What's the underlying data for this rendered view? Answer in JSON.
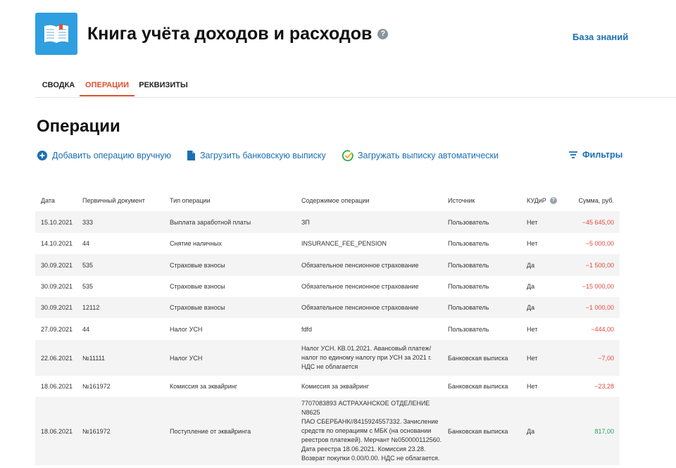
{
  "header": {
    "title": "Книга учёта доходов и расходов",
    "help_icon": "?",
    "knowledge_base": "База знаний",
    "logo_icon": "open-book-icon",
    "accent": "#2f9fe0"
  },
  "tabs": [
    {
      "label": "СВОДКА",
      "active": false
    },
    {
      "label": "ОПЕРАЦИИ",
      "active": true
    },
    {
      "label": "РЕКВИЗИТЫ",
      "active": false
    }
  ],
  "page_title": "Операции",
  "actions": {
    "add_manual": "Добавить операцию вручную",
    "upload_statement": "Загрузить банковскую выписку",
    "auto_upload": "Загружать выписку автоматически",
    "filters": "Фильтры"
  },
  "table": {
    "headers": {
      "date": "Дата",
      "doc": "Первичный документ",
      "type": "Тип операции",
      "content": "Содержимое операции",
      "source": "Источник",
      "kudir": "КУДиР",
      "kudir_help": "?",
      "amount": "Сумма, руб."
    },
    "rows": [
      {
        "date": "15.10.2021",
        "doc": "333",
        "type": "Выплата заработной платы",
        "content": "ЗП",
        "source": "Пользователь",
        "kudir": "Нет",
        "amount": "−45 645,00",
        "sign": "neg"
      },
      {
        "date": "14.10.2021",
        "doc": "44",
        "type": "Снятие наличных",
        "content": "INSURANCE_FEE_PENSION",
        "source": "Пользователь",
        "kudir": "Нет",
        "amount": "−5 000,00",
        "sign": "neg"
      },
      {
        "date": "30.09.2021",
        "doc": "535",
        "type": "Страховые взносы",
        "content": "Обязательное пенсионное страхование",
        "source": "Пользователь",
        "kudir": "Да",
        "amount": "−1 500,00",
        "sign": "neg"
      },
      {
        "date": "30.09.2021",
        "doc": "535",
        "type": "Страховые взносы",
        "content": "Обязательное пенсионное страхование",
        "source": "Пользователь",
        "kudir": "Да",
        "amount": "−15 000,00",
        "sign": "neg"
      },
      {
        "date": "30.09.2021",
        "doc": "12112",
        "type": "Страховые взносы",
        "content": "Обязательное пенсионное страхование",
        "source": "Пользователь",
        "kudir": "Да",
        "amount": "−1 000,00",
        "sign": "neg"
      },
      {
        "date": "27.09.2021",
        "doc": "44",
        "type": "Налог УСН",
        "content": "fdfd",
        "source": "Пользователь",
        "kudir": "Нет",
        "amount": "−444,00",
        "sign": "neg"
      },
      {
        "date": "22.06.2021",
        "doc": "№11111",
        "type": "Налог УСН",
        "content": "Налог УСН. КВ.01.2021. Авансовый платеж/\nналог по единому налогу при УСН за 2021 г.\nНДС не облагается",
        "source": "Банковская выписка",
        "kudir": "Нет",
        "amount": "−7,00",
        "sign": "neg"
      },
      {
        "date": "18.06.2021",
        "doc": "№161972",
        "type": "Комиссия за эквайринг",
        "content": "Комиссия за эквайринг",
        "source": "Банковская выписка",
        "kudir": "Нет",
        "amount": "−23,28",
        "sign": "neg"
      },
      {
        "date": "18.06.2021",
        "doc": "№161972",
        "type": "Поступление от эквайринга",
        "content": "7707083893 АСТРАХАНСКОЕ ОТДЕЛЕНИЕ N8625\nПАО СБЕРБАНК//8415924557332. Зачисление\nсредств по операциям с МБК (на основании\nреестров платежей). Мерчант №050000112560.\nДата реестра 18.06.2021. Комиссия 23.28.\nВозврат покупки 0.00/0.00. НДС не облагается.",
        "source": "Банковская выписка",
        "kudir": "Да",
        "amount": "817,00",
        "sign": "pos"
      }
    ]
  },
  "colors": {
    "negative": "#e04a3c",
    "positive": "#27a05a",
    "link": "#1b6fb3",
    "active_tab": "#e0502a"
  }
}
